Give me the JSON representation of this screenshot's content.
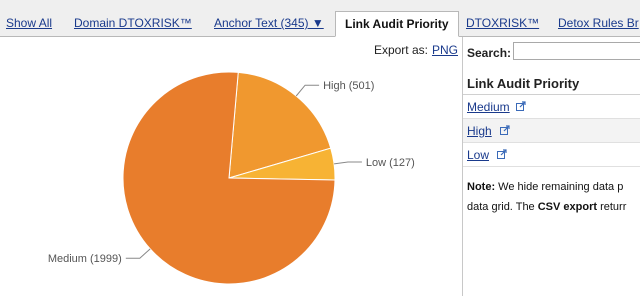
{
  "tabs": [
    {
      "label": "Show All",
      "active": false
    },
    {
      "label": "Domain DTOXRISK™",
      "active": false
    },
    {
      "label": "Anchor Text (345) ▼",
      "active": false
    },
    {
      "label": "Link Audit Priority",
      "active": true
    },
    {
      "label": "DTOXRISK™",
      "active": false
    },
    {
      "label": "Detox Rules Br",
      "active": false
    }
  ],
  "export": {
    "label": "Export as:",
    "link": "PNG"
  },
  "chart_data": {
    "type": "pie",
    "slices": [
      {
        "label": "High (501)",
        "category": "High",
        "value": 501,
        "color": "#f0982f"
      },
      {
        "label": "Low (127)",
        "category": "Low",
        "value": 127,
        "color": "#f7b334"
      },
      {
        "label": "Medium (1999)",
        "category": "Medium",
        "value": 1999,
        "color": "#e87d2c"
      }
    ]
  },
  "panel": {
    "search_label": "Search:",
    "search_value": "",
    "title": "Link Audit Priority",
    "items": [
      {
        "label": "Medium",
        "icon": "external-link-icon"
      },
      {
        "label": "High",
        "icon": "external-link-icon"
      },
      {
        "label": "Low",
        "icon": "external-link-icon"
      }
    ],
    "note": {
      "bold1": "Note:",
      "text1": " We hide remaining data p",
      "text2": "data grid. The ",
      "bold2": "CSV export",
      "text3": " returr"
    }
  }
}
